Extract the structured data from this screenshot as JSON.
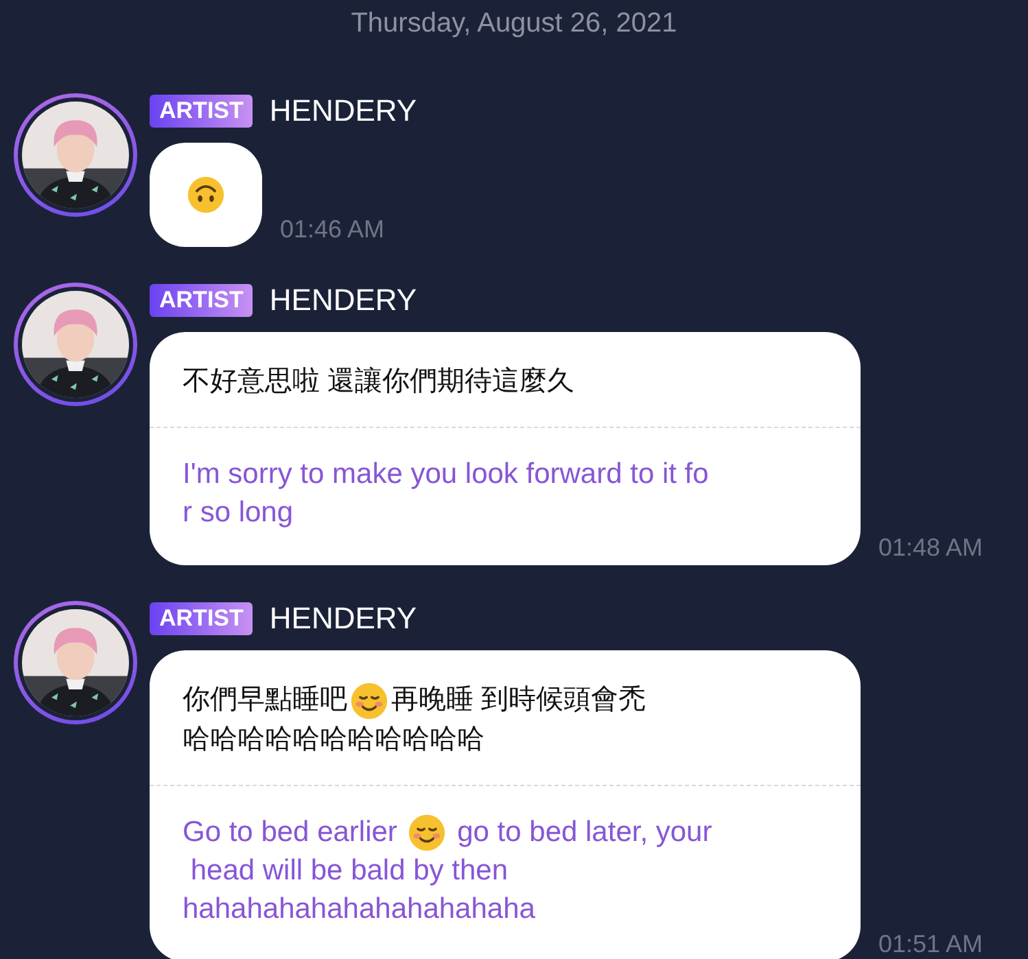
{
  "date": "Thursday, August 26, 2021",
  "messages": [
    {
      "badge": "ARTIST",
      "sender": "HENDERY",
      "time": "01:46 AM",
      "original": [
        [
          {
            "kind": "upside_down_face"
          }
        ]
      ]
    },
    {
      "badge": "ARTIST",
      "sender": "HENDERY",
      "time": "01:48 AM",
      "original": [
        [
          {
            "kind": "text",
            "text": "不好意思啦 還讓你們期待這麼久"
          }
        ]
      ],
      "translation": [
        [
          {
            "kind": "text",
            "text": "I'm sorry to make you look forward to it fo"
          }
        ],
        [
          {
            "kind": "text",
            "text": "r so long"
          }
        ]
      ]
    },
    {
      "badge": "ARTIST",
      "sender": "HENDERY",
      "time": "01:51 AM",
      "original": [
        [
          {
            "kind": "text",
            "text": "你們早點睡吧"
          },
          {
            "kind": "smiling_face"
          },
          {
            "kind": "text",
            "text": "再晚睡 到時候頭會禿"
          }
        ],
        [
          {
            "kind": "text",
            "text": "哈哈哈哈哈哈哈哈哈哈哈"
          }
        ]
      ],
      "translation": [
        [
          {
            "kind": "text",
            "text": "Go to bed earlier "
          },
          {
            "kind": "smiling_face"
          },
          {
            "kind": "text",
            "text": " go to bed later, your"
          }
        ],
        [
          {
            "kind": "text",
            "text": " head will be bald by then"
          }
        ],
        [
          {
            "kind": "text",
            "text": "hahahahahahahahahahaha"
          }
        ]
      ]
    }
  ]
}
